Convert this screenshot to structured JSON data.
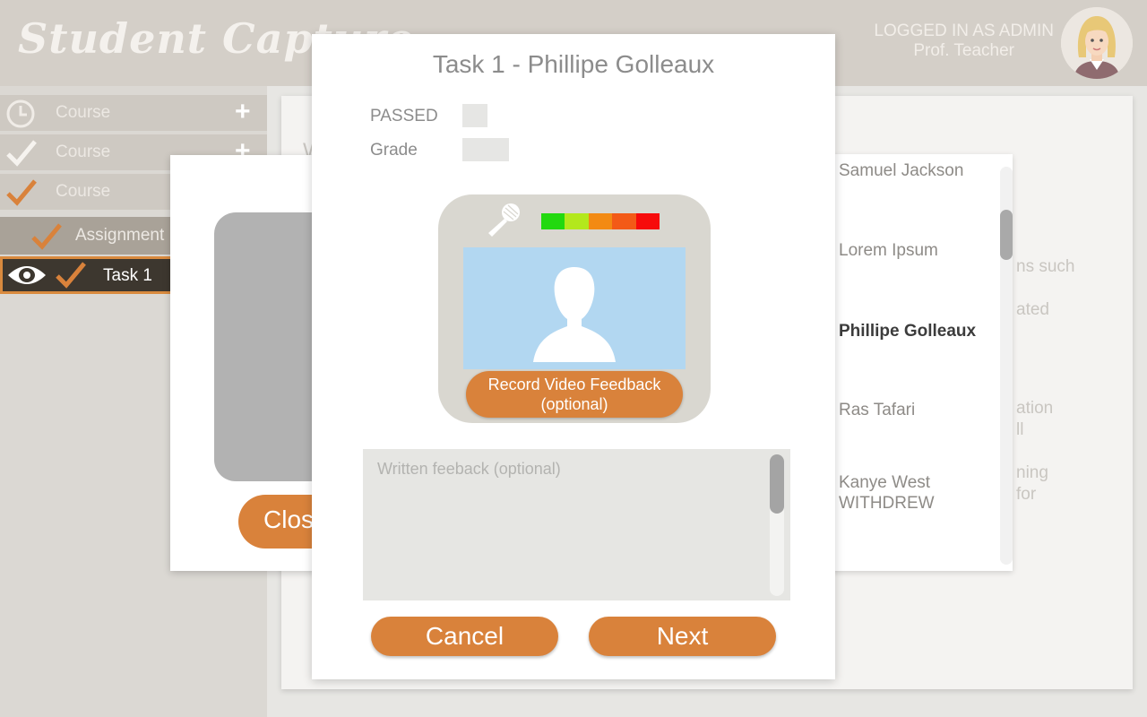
{
  "app": {
    "title": "Student Capture"
  },
  "header": {
    "logged_in_as": "LOGGED IN AS ADMIN",
    "user_name": "Prof. Teacher",
    "avatar_icon": "teacher-avatar-icon"
  },
  "sidebar": {
    "courses": [
      {
        "label": "Course",
        "icon": "clock-icon",
        "action": "+"
      },
      {
        "label": "Course",
        "icon": "check-icon",
        "action": "+"
      },
      {
        "label": "Course",
        "icon": "check-icon-orange"
      }
    ],
    "assignment": {
      "label": "Assignment",
      "icon": "check-icon-orange"
    },
    "task": {
      "label": "Task 1",
      "icons": [
        "eye-icon",
        "check-icon-orange"
      ]
    }
  },
  "background_text": {
    "heading_fragment": "W",
    "fragments": [
      "ns such",
      "ated",
      "ation",
      "ll",
      "ning",
      "for"
    ]
  },
  "back_modal": {
    "close_label": "Clos"
  },
  "students": [
    {
      "name": "Samuel Jackson"
    },
    {
      "name": "Lorem Ipsum"
    },
    {
      "name": "Phillipe Golleaux",
      "active": true
    },
    {
      "name": "Ras Tafari"
    },
    {
      "name": "Kanye West",
      "status": "WITHDREW"
    }
  ],
  "modal": {
    "title": "Task 1 - Phillipe Golleaux",
    "passed_label": "PASSED",
    "grade_label": "Grade",
    "recorder": {
      "level_colors": [
        "#22d90f",
        "#b3e81c",
        "#f38a13",
        "#f35a17",
        "#f70b0b"
      ],
      "record_label_line1": "Record Video Feedback",
      "record_label_line2": "(optional)"
    },
    "feedback_placeholder": "Written feeback (optional)",
    "feedback_value": "",
    "cancel_label": "Cancel",
    "next_label": "Next"
  },
  "colors": {
    "accent": "#d9823b",
    "header_bg": "#d4cfc8",
    "sidebar_active": "#3d372f"
  }
}
